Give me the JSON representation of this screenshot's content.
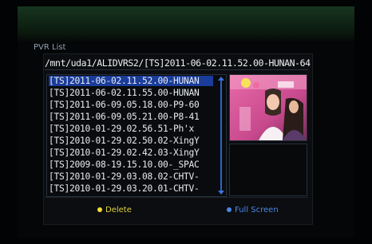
{
  "window": {
    "title": "PVR List"
  },
  "path": "/mnt/uda1/ALIDVRS2/[TS]2011-06-02.11.52.00-HUNAN-64",
  "recordings": [
    "[TS]2011-06-02.11.52.00-HUNAN",
    "[TS]2011-06-02.11.55.00-HUNAN",
    "[TS]2011-06-09.05.18.00-P9-60",
    "[TS]2011-06-09.05.21.00-P8-41",
    "[TS]2010-01-29.02.56.51-Ph'x",
    "[TS]2010-01-29.02.50.02-XingY",
    "[TS]2010-01-29.02.42.03-XingY",
    "[TS]2009-08-19.15.10.00-_SPAC",
    "[TS]2010-01-29.03.08.02-CHTV-",
    "[TS]2010-01-29.03.20.01-CHTV-"
  ],
  "selected_index": 0,
  "footer": {
    "delete_label": "Delete",
    "delete_color": "#f0df30",
    "fullscreen_label": "Full Screen",
    "fullscreen_color": "#4a87e6"
  }
}
